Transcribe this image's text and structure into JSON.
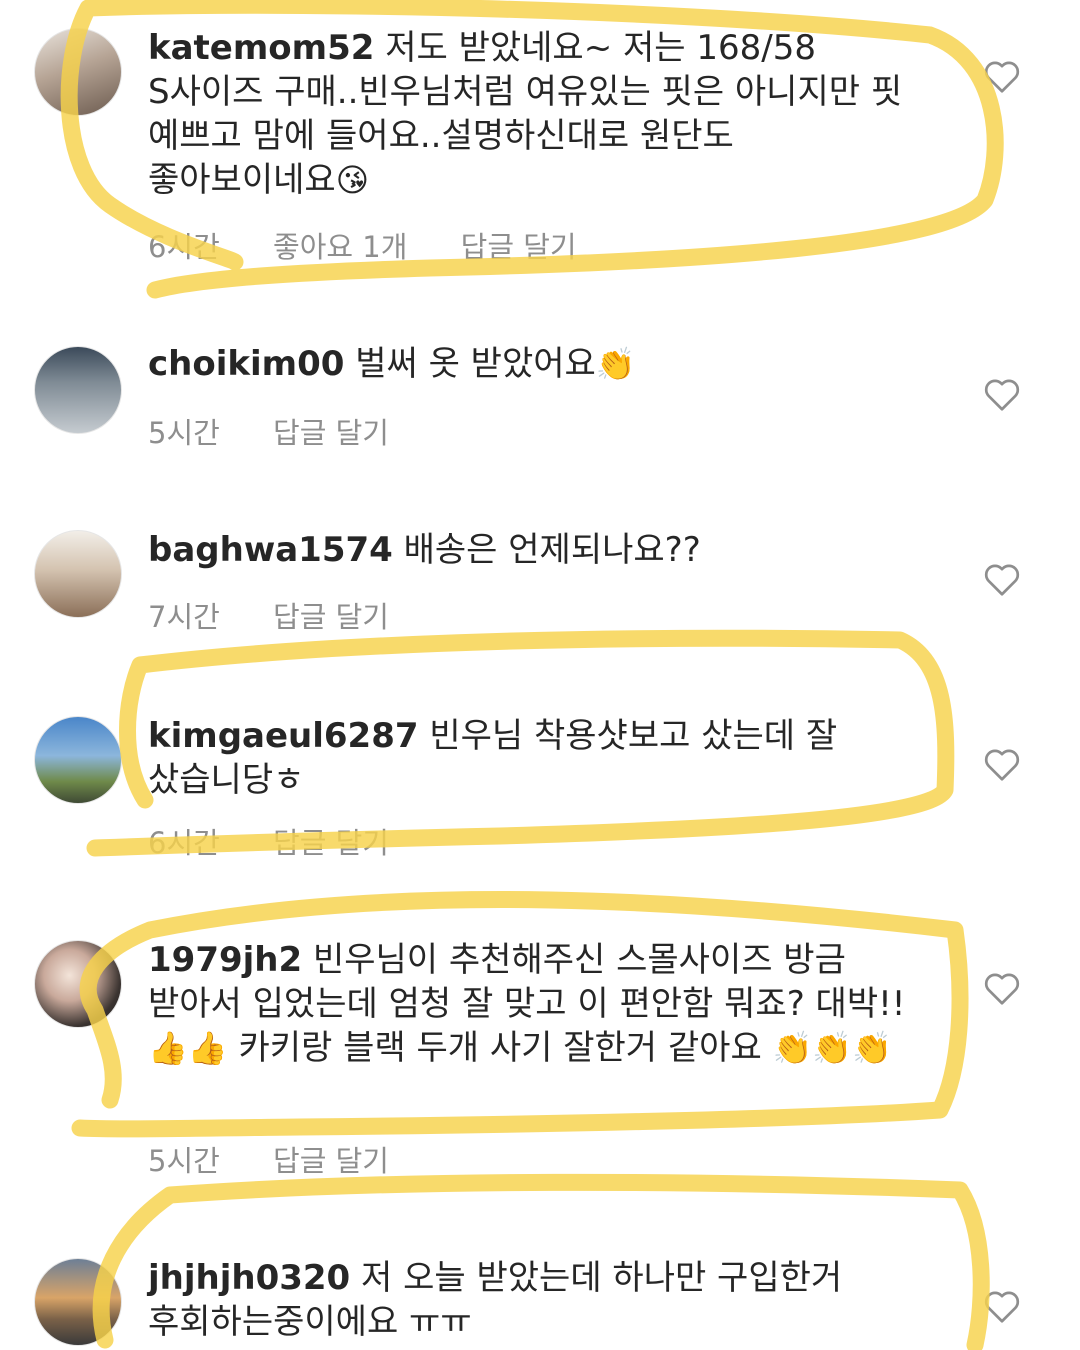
{
  "highlight_color": "#f7d24a",
  "comments": [
    {
      "username": "katemom52",
      "text": "저도 받았네요~ 저는 168/58 S사이즈 구매..빈우님처럼 여유있는 핏은 아니지만 핏 예쁘고 맘에 들어요..설명하신대로 원단도 좋아보이네요",
      "emoji": "😘",
      "time": "6시간",
      "likes": "좋아요 1개",
      "reply": "답글 달기",
      "avatar_color": "#8d7b6e",
      "highlighted": true
    },
    {
      "username": "choikim00",
      "text": "벌써 옷 받았어요",
      "emoji": "👏",
      "time": "5시간",
      "likes": "",
      "reply": "답글 달기",
      "avatar_color": "#a8b1b8",
      "highlighted": false
    },
    {
      "username": "baghwa1574",
      "text": "배송은 언제되나요??",
      "emoji": "",
      "time": "7시간",
      "likes": "",
      "reply": "답글 달기",
      "avatar_color": "#c9b9a8",
      "highlighted": false
    },
    {
      "username": "kimgaeul6287",
      "text": "빈우님 착용샷보고 샀는데 잘 샀습니당ㅎ",
      "emoji": "",
      "time": "6시간",
      "likes": "",
      "reply": "답글 달기",
      "avatar_color": "#5f89b5",
      "highlighted": true
    },
    {
      "username": "1979jh2",
      "text": "빈우님이 추천해주신 스몰사이즈 방금 받아서 입었는데 엄청 잘 맞고 이 편안함 뭐죠? 대박!!",
      "emoji_pre": "👍👍",
      "text2": "카키랑 블랙 두개 사기 잘한거 같아요",
      "emoji": "👏👏👏",
      "time": "5시간",
      "likes": "",
      "reply": "답글 달기",
      "avatar_color": "#3a3330",
      "highlighted": true
    },
    {
      "username": "jhjhjh0320",
      "text": "저 오늘 받았는데 하나만 구입한거 후회하는중이에요 ㅠㅠ",
      "emoji": "",
      "time": "",
      "likes": "",
      "reply": "",
      "avatar_color": "#b89466",
      "highlighted": true
    }
  ]
}
